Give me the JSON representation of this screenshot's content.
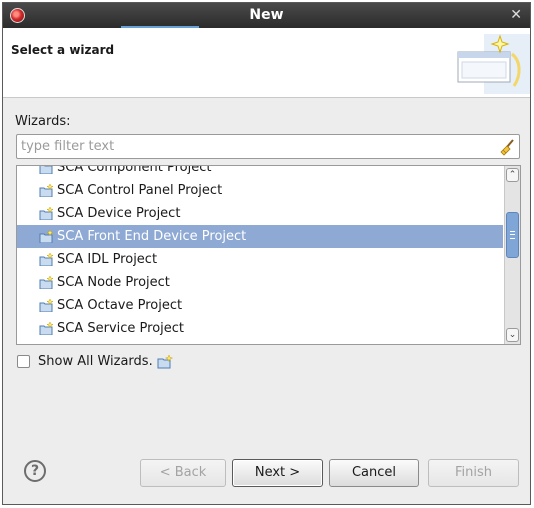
{
  "window": {
    "title": "New"
  },
  "header": {
    "title": "Select a wizard"
  },
  "wizards_label": "Wizards:",
  "filter": {
    "placeholder": "type filter text",
    "value": ""
  },
  "list": {
    "items": [
      {
        "label": "SCA Component Project",
        "icon": "new-project-icon",
        "selected": false
      },
      {
        "label": "SCA Control Panel Project",
        "icon": "new-project-icon",
        "selected": false
      },
      {
        "label": "SCA Device Project",
        "icon": "new-project-icon",
        "selected": false
      },
      {
        "label": "SCA Front End Device Project",
        "icon": "new-project-icon",
        "selected": true
      },
      {
        "label": "SCA IDL Project",
        "icon": "new-project-icon",
        "selected": false
      },
      {
        "label": "SCA Node Project",
        "icon": "new-project-icon",
        "selected": false
      },
      {
        "label": "SCA Octave Project",
        "icon": "new-project-icon",
        "selected": false
      },
      {
        "label": "SCA Service Project",
        "icon": "new-project-icon",
        "selected": false
      }
    ],
    "selection_color": "#8ea9d3"
  },
  "show_all": {
    "label": "Show All Wizards.",
    "checked": false
  },
  "buttons": {
    "back": "< Back",
    "next": "Next >",
    "cancel": "Cancel",
    "finish": "Finish"
  }
}
